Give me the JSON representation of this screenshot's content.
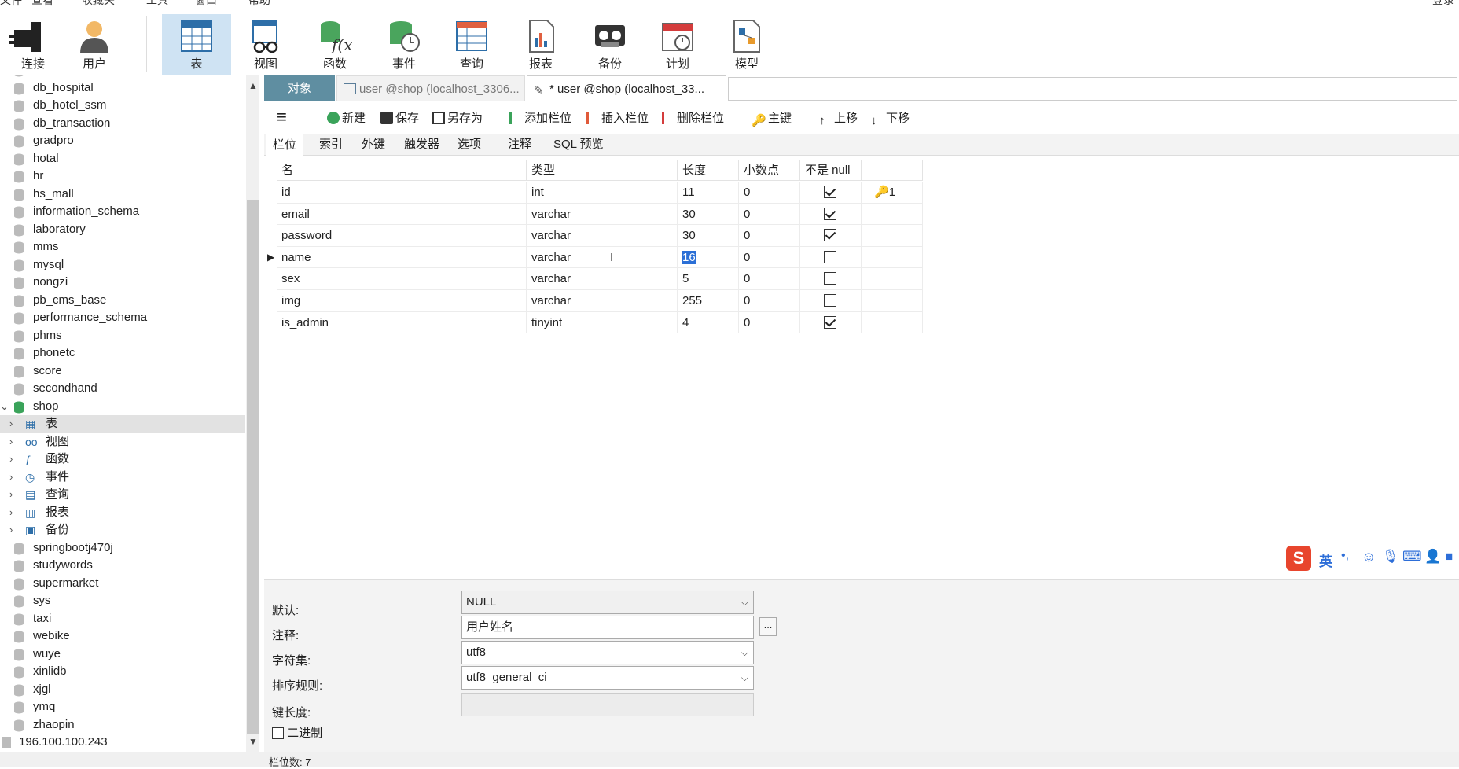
{
  "menubar": {
    "items": [
      "文件",
      "查看",
      "收藏夹",
      "工具",
      "窗口",
      "帮助"
    ],
    "right": "登录"
  },
  "toolbar": {
    "items": [
      {
        "label": "连接",
        "icon": "plug-icon"
      },
      {
        "label": "用户",
        "icon": "user-icon"
      },
      {
        "label": "表",
        "icon": "table-icon",
        "active": true
      },
      {
        "label": "视图",
        "icon": "view-icon"
      },
      {
        "label": "函数",
        "icon": "function-icon"
      },
      {
        "label": "事件",
        "icon": "event-icon"
      },
      {
        "label": "查询",
        "icon": "query-icon"
      },
      {
        "label": "报表",
        "icon": "report-icon"
      },
      {
        "label": "备份",
        "icon": "backup-icon"
      },
      {
        "label": "计划",
        "icon": "schedule-icon"
      },
      {
        "label": "模型",
        "icon": "model-icon"
      }
    ]
  },
  "sidebar": {
    "databases_before": [
      "db_hospital",
      "db_hotel_ssm",
      "db_transaction",
      "gradpro",
      "hotal",
      "hr",
      "hs_mall",
      "information_schema",
      "laboratory",
      "mms",
      "mysql",
      "nongzi",
      "pb_cms_base",
      "performance_schema",
      "phms",
      "phonetc",
      "score",
      "secondhand"
    ],
    "open_database": "shop",
    "open_children": [
      {
        "label": "表",
        "icon": "table-icon",
        "selected": true
      },
      {
        "label": "视图",
        "icon": "view-icon"
      },
      {
        "label": "函数",
        "icon": "function-icon"
      },
      {
        "label": "事件",
        "icon": "event-icon"
      },
      {
        "label": "查询",
        "icon": "query-icon"
      },
      {
        "label": "报表",
        "icon": "report-icon"
      },
      {
        "label": "备份",
        "icon": "backup-icon"
      }
    ],
    "databases_after": [
      "springbootj470j",
      "studywords",
      "supermarket",
      "sys",
      "taxi",
      "webike",
      "wuye",
      "xinlidb",
      "xjgl",
      "ymq",
      "zhaopin"
    ],
    "connection": "196.100.100.243"
  },
  "tabs": {
    "objects": "对象",
    "tab1": "user @shop (localhost_3306...",
    "tab2": "* user @shop (localhost_33..."
  },
  "actions": {
    "menu": "≡",
    "new": "新建",
    "save": "保存",
    "save_as": "另存为",
    "add_field": "添加栏位",
    "insert_field": "插入栏位",
    "delete_field": "删除栏位",
    "primary_key": "主键",
    "move_up": "上移",
    "move_down": "下移"
  },
  "subtabs": [
    "栏位",
    "索引",
    "外键",
    "触发器",
    "选项",
    "注释",
    "SQL 预览"
  ],
  "grid": {
    "headers": {
      "name": "名",
      "type": "类型",
      "length": "长度",
      "decimals": "小数点",
      "not_null": "不是 null"
    },
    "rows": [
      {
        "name": "id",
        "type": "int",
        "length": "11",
        "decimals": "0",
        "not_null": true,
        "key": "1"
      },
      {
        "name": "email",
        "type": "varchar",
        "length": "30",
        "decimals": "0",
        "not_null": true,
        "key": ""
      },
      {
        "name": "password",
        "type": "varchar",
        "length": "30",
        "decimals": "0",
        "not_null": true,
        "key": ""
      },
      {
        "name": "name",
        "type": "varchar",
        "length": "16",
        "decimals": "0",
        "not_null": false,
        "key": "",
        "current": true
      },
      {
        "name": "sex",
        "type": "varchar",
        "length": "5",
        "decimals": "0",
        "not_null": false,
        "key": ""
      },
      {
        "name": "img",
        "type": "varchar",
        "length": "255",
        "decimals": "0",
        "not_null": false,
        "key": ""
      },
      {
        "name": "is_admin",
        "type": "tinyint",
        "length": "4",
        "decimals": "0",
        "not_null": true,
        "key": ""
      }
    ]
  },
  "props": {
    "default_label": "默认:",
    "default_value": "NULL",
    "comment_label": "注释:",
    "comment_value": "用户姓名",
    "comment_btn": "...",
    "charset_label": "字符集:",
    "charset_value": "utf8",
    "collation_label": "排序规则:",
    "collation_value": "utf8_general_ci",
    "keylen_label": "键长度:",
    "keylen_value": "",
    "binary_label": "二进制"
  },
  "status": {
    "field_count": "栏位数: 7"
  },
  "ime": {
    "lang": "英",
    "punct": "•,"
  },
  "colors": {
    "active_tool": "#cfe3f3",
    "objects_tab": "#5f8ea1",
    "selection": "#2b6fd6",
    "db_green": "#3aa35a"
  }
}
